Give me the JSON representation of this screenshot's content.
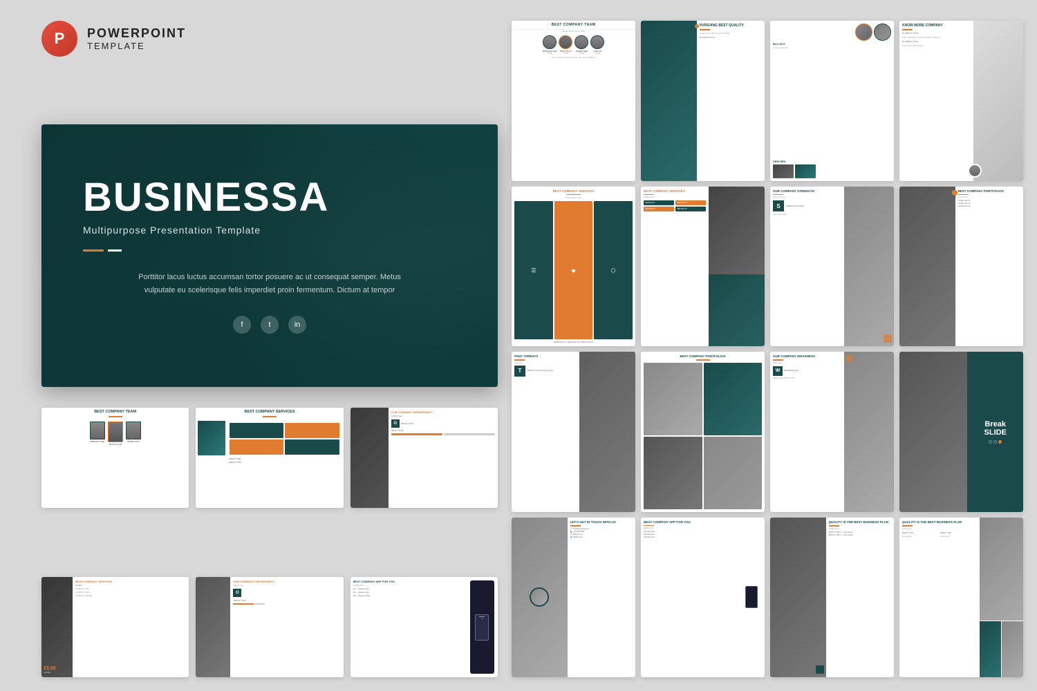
{
  "header": {
    "icon_letter": "P",
    "title": "POWERPOINT",
    "subtitle": "TEMPLATE"
  },
  "hero": {
    "title": "BUSINESSA",
    "subtitle": "Multipurpose Presentation Template",
    "description": "Porttitor lacus luctus accumsan tortor posuere ac ut consequat semper. Metus vulputate eu scelerisque felis imperdiet proin fermentum. Dictum at tempor",
    "social_icons": [
      "f",
      "t",
      "in"
    ]
  },
  "slides": {
    "best_company_team_label": "BEST COMPANY TEAM",
    "best_company_services_label": "BEST COMPANY SERVICES",
    "best_company_portfolios_label": "BEST COMPANY PORTFOLIOS",
    "our_company_strength_label": "OUR COMPANY STRENGTH",
    "our_company_weakness_label": "OUR COMPANY WEAKNESS",
    "our_company_opportunity_label": "OUR COMPANY OPPORTUNITY",
    "best_company_app_label": "BEST COMPANY APP FOR YOU",
    "pursuing_best_quality_label": "PURSUING BEST QUALITY",
    "know_more_company_label": "KNOW MORE COMPANY",
    "best_company_portfolios2_label": "BEST COMPANY PORTFOLIOS",
    "quality_business_plan_label": "QUALITY IS THE BEST BUSINESS PLAN",
    "lets_get_in_touch_label": "LET'S GET IN TOUCH WITH US",
    "break_slide_label": "Break SLIDE",
    "company_threats_label": "PANY THREATS",
    "team_members": [
      "MORGAN CHE",
      "RON FOLST",
      "JAMES DEN",
      "LINA LIN"
    ],
    "team_members2": [
      "MORGAN CHE",
      "APOLLO PLR",
      "JAMES GUN"
    ],
    "stat_value": "23.5K",
    "opportunity_label": "Our companY opportunity"
  }
}
